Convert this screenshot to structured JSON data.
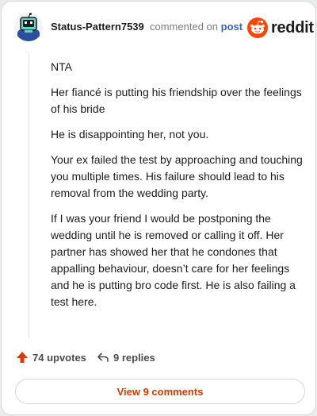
{
  "header": {
    "username": "Status-Pattern7539",
    "action_text": "commented on",
    "post_link": "post",
    "brand": "reddit",
    "avatar_icon": "snoo-avatar-icon",
    "brand_icon": "reddit-logo-icon",
    "brand_color": "#ff4500"
  },
  "comment": {
    "paragraphs": [
      "NTA",
      "Her fiancé is putting his friendship over the feelings of his bride",
      "He is disappointing her, not you.",
      "Your ex failed the test by approaching and touching you multiple times. His failure should lead to his removal from the wedding party.",
      "If I was your friend I would be postponing the wedding until he is removed or calling it off. Her partner has showed her that he condones that appalling behaviour, doesn’t care for her feelings and he is putting bro code first. He is also failing a test here."
    ]
  },
  "actions": {
    "upvotes": "74 upvotes",
    "replies": "9 replies",
    "upvote_icon": "upvote-arrow-icon",
    "reply_icon": "reply-arrow-icon",
    "upvote_color": "#d93a00"
  },
  "footer": {
    "view_comments": "View 9 comments"
  }
}
